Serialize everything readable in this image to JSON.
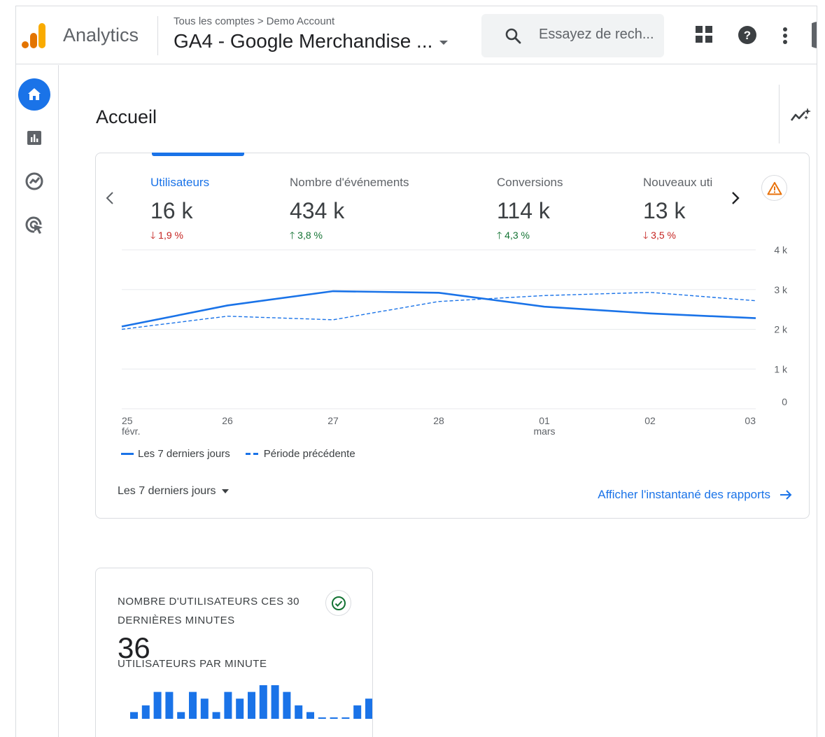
{
  "header": {
    "app_name": "Analytics",
    "breadcrumb": [
      "Tous les comptes",
      "Demo Account"
    ],
    "property": "GA4 - Google Merchandise ...",
    "search_placeholder": "Essayez de rech..."
  },
  "page": {
    "title": "Accueil"
  },
  "metrics": [
    {
      "label": "Utilisateurs",
      "value": "16 k",
      "delta": "1,9 %",
      "direction": "down"
    },
    {
      "label": "Nombre d'événements",
      "value": "434 k",
      "delta": "3,8 %",
      "direction": "up"
    },
    {
      "label": "Conversions",
      "value": "114 k",
      "delta": "4,3 %",
      "direction": "up"
    },
    {
      "label": "Nouveaux uti",
      "value": "13 k",
      "delta": "3,5 %",
      "direction": "down"
    }
  ],
  "chart_data": {
    "type": "line",
    "x": [
      "25",
      "26",
      "27",
      "28",
      "01",
      "02",
      "03"
    ],
    "x_sublabels": [
      "févr.",
      "",
      "",
      "",
      "mars",
      "",
      ""
    ],
    "y_ticks": [
      "4 k",
      "3 k",
      "2 k",
      "1 k",
      "0"
    ],
    "ylim": [
      0,
      4000
    ],
    "series": [
      {
        "name": "Les 7 derniers jours",
        "style": "solid",
        "values": [
          2070,
          2600,
          2960,
          2920,
          2570,
          2400,
          2280
        ]
      },
      {
        "name": "Période précédente",
        "style": "dashed",
        "values": [
          2000,
          2330,
          2240,
          2700,
          2850,
          2930,
          2720
        ]
      }
    ],
    "grid": true,
    "legend_position": "bottom-left",
    "color": "#1a73e8"
  },
  "footer": {
    "range_label": "Les 7 derniers jours",
    "report_link": "Afficher l'instantané des rapports"
  },
  "realtime": {
    "title": "NOMBRE D'UTILISATEURS CES 30 DERNIÈRES MINUTES",
    "value": "36",
    "subtitle": "UTILISATEURS PAR MINUTE",
    "bars": [
      1,
      2,
      4,
      4,
      1,
      4,
      3,
      1,
      4,
      3,
      4,
      5,
      5,
      4,
      2,
      1,
      0,
      0,
      0,
      2,
      3
    ]
  },
  "colors": {
    "accent": "#1a73e8",
    "positive": "#137333",
    "negative": "#c5221f",
    "warning": "#e8710a",
    "logo_orange": "#f9ab00",
    "logo_dark": "#e37400"
  },
  "icons": [
    "analytics-logo-icon",
    "chevron-right-icon",
    "dropdown-caret-icon",
    "search-icon",
    "apps-grid-icon",
    "help-icon",
    "more-vert-icon",
    "home-icon",
    "reports-icon",
    "explore-icon",
    "advertising-icon",
    "insights-icon",
    "chevron-left-icon",
    "warning-icon",
    "arrow-down-icon",
    "arrow-up-icon",
    "arrow-right-icon",
    "check-circle-icon"
  ]
}
